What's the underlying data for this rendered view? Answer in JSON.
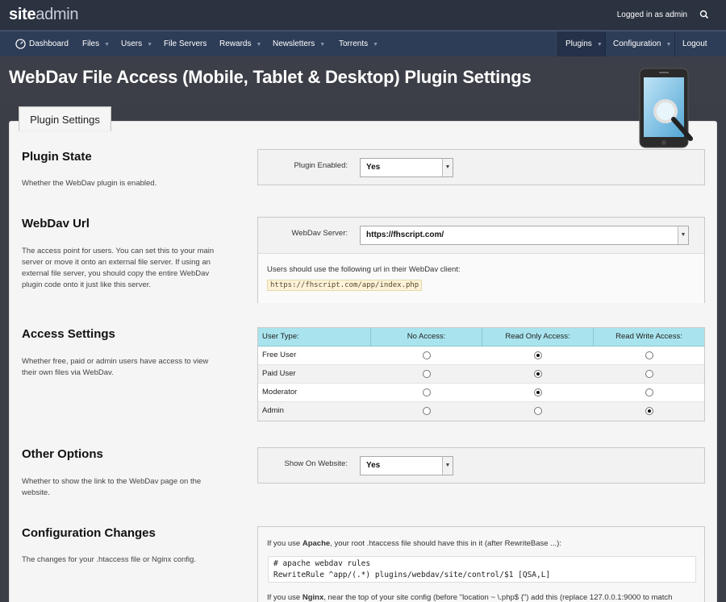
{
  "brand": {
    "name_bold": "site",
    "name_light": "admin"
  },
  "header": {
    "logged_in": "Logged in as admin"
  },
  "nav": {
    "items": [
      {
        "label": "Dashboard"
      },
      {
        "label": "Files"
      },
      {
        "label": "Users"
      },
      {
        "label": "File Servers"
      },
      {
        "label": "Rewards"
      },
      {
        "label": "Newsletters"
      },
      {
        "label": "Torrents"
      }
    ],
    "right": [
      {
        "label": "Plugins"
      },
      {
        "label": "Configuration"
      },
      {
        "label": "Logout"
      }
    ]
  },
  "page": {
    "title": "WebDav File Access (Mobile, Tablet & Desktop) Plugin Settings",
    "tab": "Plugin Settings"
  },
  "plugin_state": {
    "heading": "Plugin State",
    "desc": "Whether the WebDav plugin is enabled.",
    "label": "Plugin Enabled:",
    "value": "Yes"
  },
  "webdav_url": {
    "heading": "WebDav Url",
    "desc": "The access point for users. You can set this to your main server or move it onto an external file server. If using an external file server, you should copy the entire WebDav plugin code onto it just like this server.",
    "label": "WebDav Server:",
    "value": "https://fhscript.com/",
    "hint": "Users should use the following url in their WebDav client:",
    "url": "https://fhscript.com/app/index.php"
  },
  "access": {
    "heading": "Access Settings",
    "desc": "Whether free, paid or admin users have access to view their own files via WebDav.",
    "columns": [
      "User Type:",
      "No Access:",
      "Read Only Access:",
      "Read Write Access:"
    ],
    "rows": [
      {
        "type": "Free User",
        "selected": 2
      },
      {
        "type": "Paid User",
        "selected": 2
      },
      {
        "type": "Moderator",
        "selected": 2
      },
      {
        "type": "Admin",
        "selected": 3
      }
    ]
  },
  "other": {
    "heading": "Other Options",
    "desc": "Whether to show the link to the WebDav page on the website.",
    "label": "Show On Website:",
    "value": "Yes"
  },
  "config": {
    "heading": "Configuration Changes",
    "desc": "The changes for your .htaccess file or Nginx config.",
    "apache_pre": "If you use ",
    "apache_bold": "Apache",
    "apache_post": ", your root .htaccess file should have this in it (after RewriteBase ...):",
    "code_line1": "# apache webdav rules",
    "code_line2": "RewriteRule ^app/(.*) plugins/webdav/site/control/$1 [QSA,L]",
    "nginx_pre": "If you use ",
    "nginx_bold": "Nginx",
    "nginx_post": ", near the top of your site config (before \"location ~ \\.php$ {\") add this (replace 127.0.0.1:9000 to match"
  }
}
